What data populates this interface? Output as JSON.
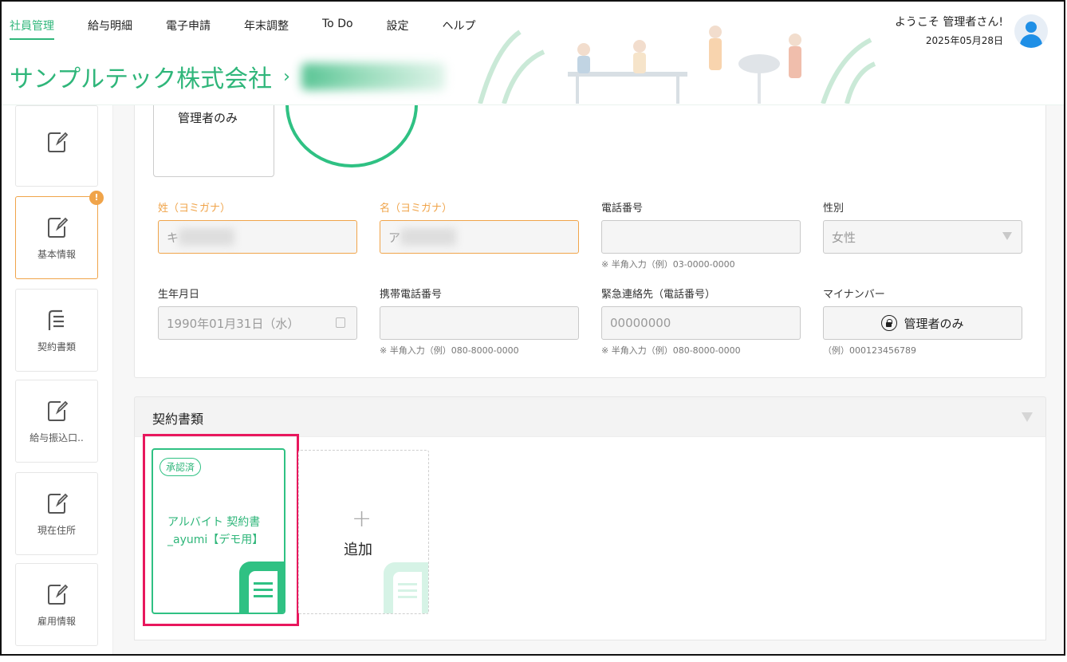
{
  "nav": {
    "items": [
      {
        "label": "社員管理",
        "active": true
      },
      {
        "label": "給与明細"
      },
      {
        "label": "電子申請"
      },
      {
        "label": "年末調整"
      },
      {
        "label": "To Do"
      },
      {
        "label": "設定"
      },
      {
        "label": "ヘルプ"
      }
    ]
  },
  "user": {
    "welcome": "ようこそ 管理者さん!",
    "date": "2025年05月28日"
  },
  "breadcrumb": {
    "company": "サンプルテック株式会社",
    "separator": "›"
  },
  "photo": {
    "admin_only_label": "管理者のみ"
  },
  "sidebar": {
    "items": [
      {
        "label": "",
        "icon": "edit-icon"
      },
      {
        "label": "基本情報",
        "icon": "edit-icon",
        "active": true,
        "badge": "!"
      },
      {
        "label": "契約書類",
        "icon": "document-icon"
      },
      {
        "label": "給与振込口..",
        "icon": "edit-icon"
      },
      {
        "label": "現在住所",
        "icon": "edit-icon"
      },
      {
        "label": "雇用情報",
        "icon": "edit-icon"
      }
    ]
  },
  "form": {
    "last_kana": {
      "label": "姓（ヨミガナ）",
      "value": "キ"
    },
    "first_kana": {
      "label": "名（ヨミガナ）",
      "value": "ア"
    },
    "phone": {
      "label": "電話番号",
      "value": "",
      "hint": "※ 半角入力（例）03-0000-0000"
    },
    "gender": {
      "label": "性別",
      "value": "女性"
    },
    "birthdate": {
      "label": "生年月日",
      "value": "1990年01月31日（水）"
    },
    "mobile": {
      "label": "携帯電話番号",
      "value": "",
      "hint": "※ 半角入力（例）080-8000-0000"
    },
    "emergency": {
      "label": "緊急連絡先（電話番号）",
      "value": "00000000",
      "hint": "※ 半角入力（例）080-8000-0000"
    },
    "mynumber": {
      "label": "マイナンバー",
      "button": "管理者のみ",
      "hint": "（例）000123456789"
    }
  },
  "contracts": {
    "section_title": "契約書類",
    "cards": [
      {
        "status": "承認済",
        "title": "アルバイト 契約書_ayumi【デモ用】"
      }
    ],
    "add_label": "追加",
    "add_symbol": "+"
  },
  "colors": {
    "accent": "#2fb67a",
    "warning": "#f0a44a",
    "highlight": "#e8175d"
  }
}
